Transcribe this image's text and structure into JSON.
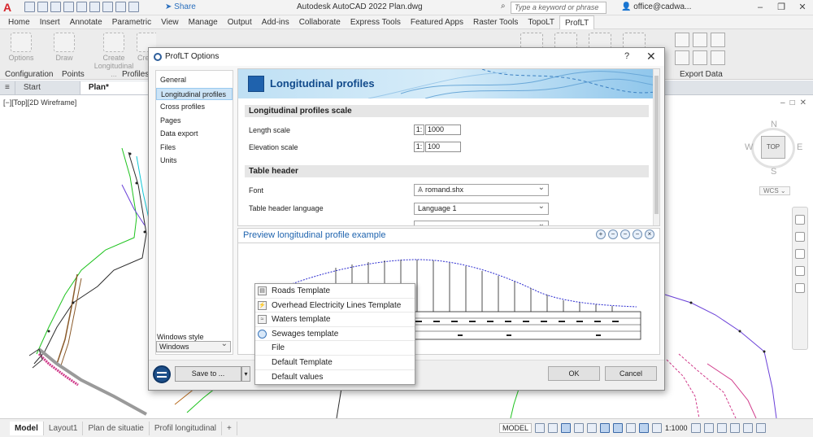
{
  "titlebar": {
    "logo": "A",
    "share_label": "Share",
    "app_title": "Autodesk AutoCAD 2022   Plan.dwg",
    "search_placeholder": "Type a keyword or phrase",
    "user": "office@cadwa...",
    "window_buttons": [
      "–",
      "❐",
      "✕"
    ]
  },
  "ribbon": {
    "tabs": [
      "Home",
      "Insert",
      "Annotate",
      "Parametric",
      "View",
      "Manage",
      "Output",
      "Add-ins",
      "Collaborate",
      "Express Tools",
      "Featured Apps",
      "Raster Tools",
      "TopoLT",
      "ProfLT"
    ],
    "active_tab": "ProfLT",
    "buttons": {
      "options": "Options",
      "draw": "Draw",
      "create_longitudinal": "Create Longitudinal ...",
      "create": "Creat"
    },
    "groups": {
      "configuration": "Configuration",
      "points": "Points",
      "profiles": "Profiles",
      "export_data": "Export Data"
    }
  },
  "file_tabs": {
    "menu": "≡",
    "items": [
      "Start",
      "Plan*"
    ],
    "active": "Plan*",
    "add": "+"
  },
  "viewport": {
    "label": "[−][Top][2D Wireframe]",
    "controls": [
      "–",
      "□",
      "✕"
    ],
    "viewcube": {
      "n": "N",
      "s": "S",
      "w": "W",
      "e": "E",
      "top": "TOP"
    },
    "wcs": "WCS ⌄"
  },
  "dialog": {
    "title": "ProfLT Options",
    "help": "?",
    "close": "✕",
    "nav": [
      "General",
      "Longitudinal profiles",
      "Cross profiles",
      "Pages",
      "Data export",
      "Files",
      "Units"
    ],
    "nav_active": "Longitudinal profiles",
    "windows_style_label": "Windows style",
    "windows_style_value": "Windows",
    "banner_title": "Longitudinal profiles",
    "scale_section": "Longitudinal profiles scale",
    "length_scale_label": "Length scale",
    "length_scale_prefix": "1:",
    "length_scale_value": "1000",
    "elevation_scale_label": "Elevation scale",
    "elevation_scale_prefix": "1:",
    "elevation_scale_value": "100",
    "table_header_section": "Table header",
    "font_label": "Font",
    "font_value": "romand.shx",
    "language_label": "Table header language",
    "language_value": "Language 1",
    "preview_title": "Preview longitudinal profile example",
    "zoom_tools": [
      "+",
      "−",
      "−",
      "−",
      "×"
    ],
    "save_to": "Save to ...",
    "ok": "OK",
    "cancel": "Cancel"
  },
  "save_menu": {
    "items": [
      {
        "label": "Roads Template",
        "icon": "road-template-icon"
      },
      {
        "label": "Overhead Electricity Lines Template",
        "icon": "electricity-template-icon"
      },
      {
        "label": "Waters template",
        "icon": "waters-template-icon"
      },
      {
        "label": "Sewages template",
        "icon": "sewages-template-icon"
      },
      {
        "label": "File",
        "icon": ""
      },
      {
        "label": "Default Template",
        "icon": ""
      },
      {
        "label": "Default values",
        "icon": ""
      }
    ]
  },
  "layout_tabs": {
    "items": [
      "Model",
      "Layout1",
      "Plan de situatie",
      "Profil longitudinal"
    ],
    "active": "Model",
    "add": "+"
  },
  "statusbar": {
    "model": "MODEL",
    "scale": "1:1000"
  },
  "colors": {
    "accent": "#1e63ae",
    "autocad_red": "#d6262c",
    "selection": "#cce4f7"
  }
}
